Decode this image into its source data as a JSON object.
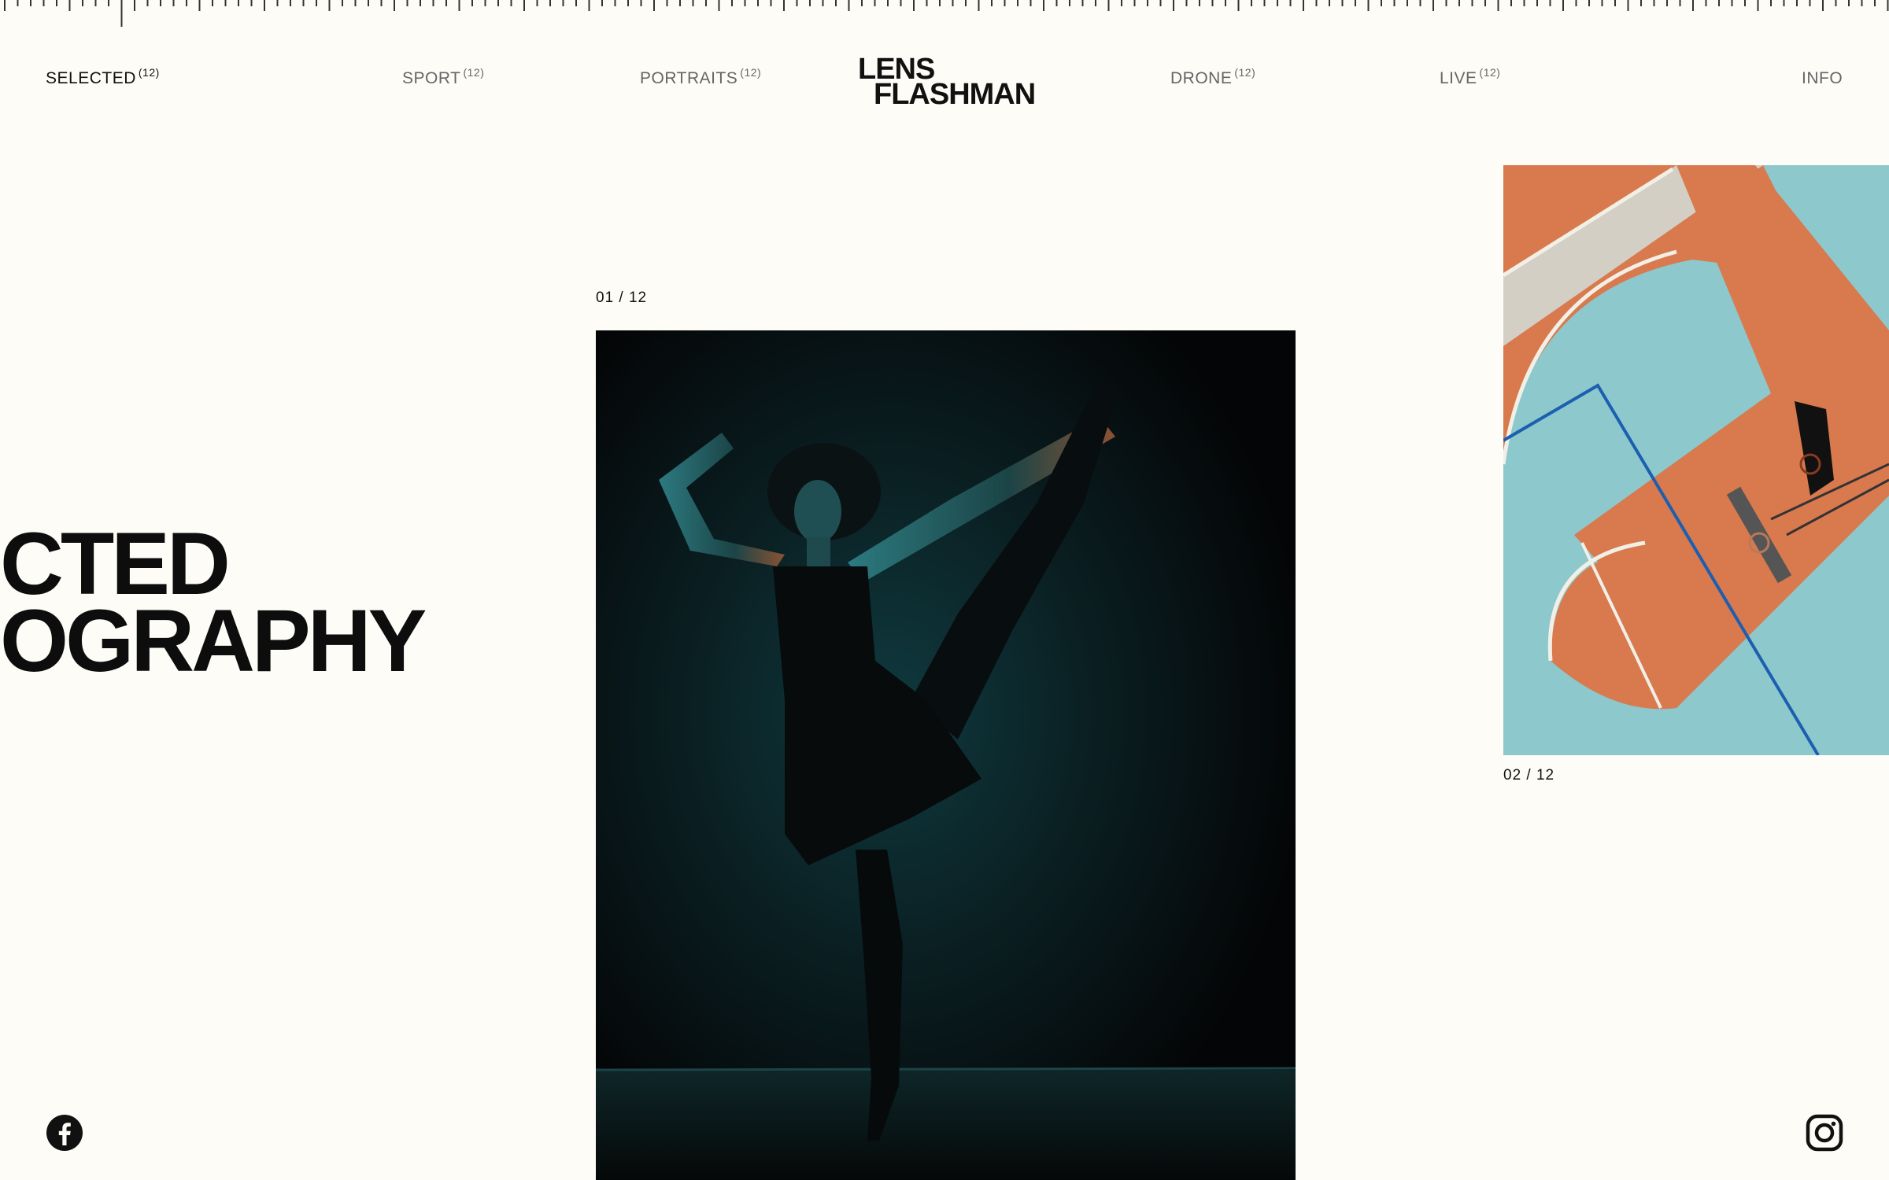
{
  "nav": {
    "items": [
      {
        "label": "SELECTED",
        "count": "(12)",
        "active": true
      },
      {
        "label": "SPORT",
        "count": "(12)",
        "active": false
      },
      {
        "label": "PORTRAITS",
        "count": "(12)",
        "active": false
      },
      {
        "label": "DRONE",
        "count": "(12)",
        "active": false
      },
      {
        "label": "LIVE",
        "count": "(12)",
        "active": false
      }
    ],
    "info_label": "INFO"
  },
  "logo": {
    "line1": "LENS",
    "line2": "FLASHMAN"
  },
  "hero": {
    "line1": "CTED",
    "line2": "OGRAPHY"
  },
  "gallery": {
    "counter_1": "01 / 12",
    "counter_2": "02 / 12"
  },
  "social": {
    "left_icon": "facebook-icon",
    "right_icon": "instagram-icon"
  },
  "colors": {
    "background": "#fdfcf6",
    "text": "#111111",
    "muted": "#666666",
    "court_orange": "#d9794e",
    "court_teal": "#8cc8cc"
  }
}
